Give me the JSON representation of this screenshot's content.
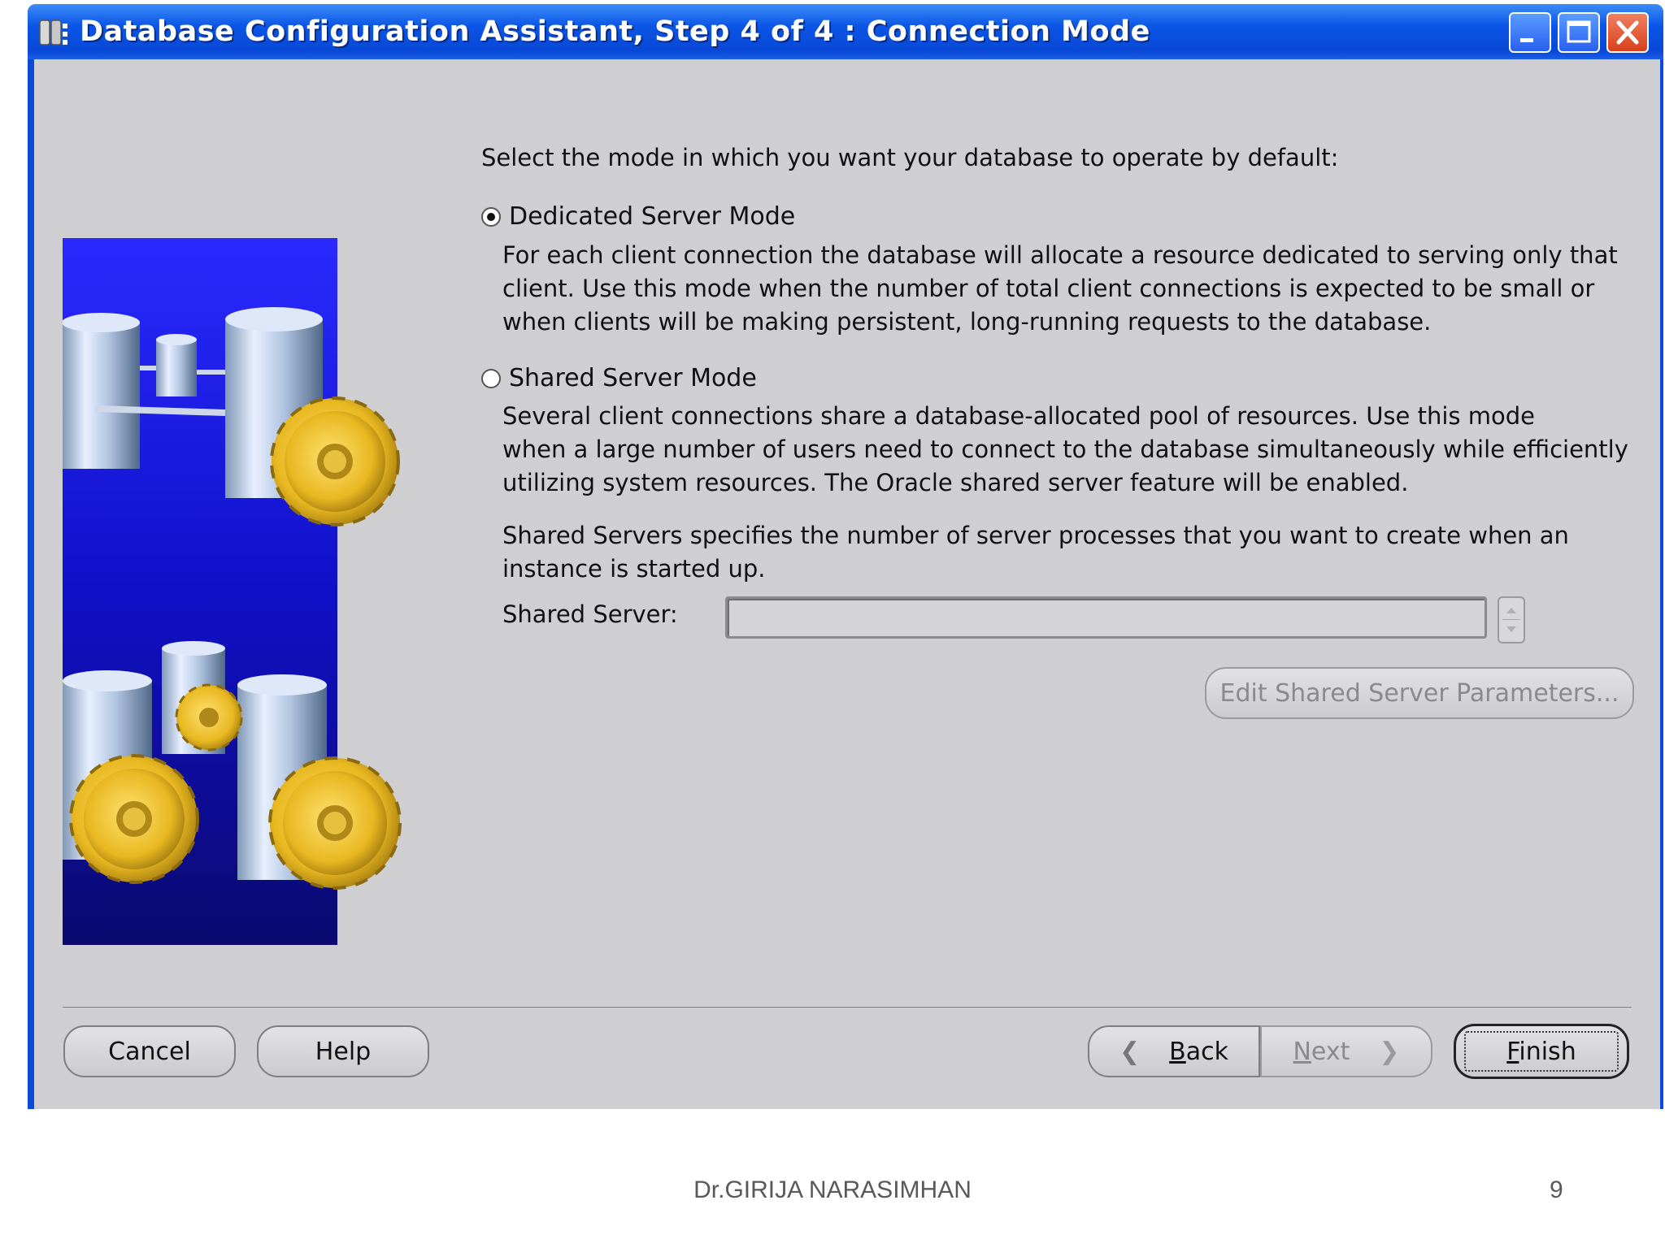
{
  "window": {
    "title": "Database Configuration Assistant, Step 4 of 4 : Connection Mode",
    "controls": [
      "minimize",
      "maximize",
      "close"
    ]
  },
  "main": {
    "instruction": "Select the mode in which you want your database to operate by default:",
    "options": [
      {
        "label": "Dedicated Server Mode",
        "checked": true,
        "description_lines": [
          "For each client connection the database will allocate a resource dedicated to serving only that",
          "client.  Use this mode when the number of total client connections is expected to be small or",
          "when clients will be making persistent, long-running requests to the database."
        ]
      },
      {
        "label": "Shared Server Mode",
        "checked": false,
        "description_lines": [
          "Several client connections share a database-allocated pool of resources.  Use this mode",
          "when a large number of users need to connect to the database simultaneously while efficiently",
          "utilizing system resources.  The Oracle shared server feature will be enabled."
        ]
      }
    ],
    "shared_servers_note_lines": [
      "Shared Servers specifies the number of server processes that you want to create when an",
      "instance is started up."
    ],
    "shared_server_label": "Shared Server:",
    "shared_server_value": "",
    "edit_params_button": "Edit Shared Server Parameters..."
  },
  "footer_buttons": {
    "cancel": "Cancel",
    "help": "Help",
    "back_mnemonic": "B",
    "back_rest": "ack",
    "next_mnemonic": "N",
    "next_rest": "ext",
    "finish_mnemonic": "F",
    "finish_rest": "inish"
  },
  "slide_footer": {
    "author": "Dr.GIRIJA NARASIMHAN",
    "page": "9"
  },
  "colors": {
    "titlebar": "#0b55e6",
    "dialog_bg": "#cfcfd2",
    "illustration_bg": "#1a1acc",
    "gear": "#e8b820"
  },
  "icons": [
    "database-app-icon",
    "minimize-icon",
    "maximize-icon",
    "close-icon",
    "chevron-left-icon",
    "chevron-right-icon",
    "spinner-up-icon",
    "spinner-down-icon"
  ]
}
